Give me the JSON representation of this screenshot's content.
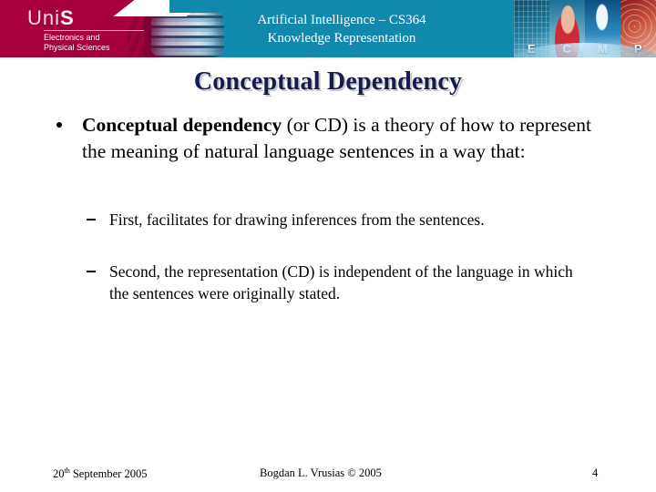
{
  "header": {
    "logo": {
      "brand_prefix": "Uni",
      "brand_suffix": "S",
      "faculty_line1": "Electronics and",
      "faculty_line2": "Physical Sciences"
    },
    "course_title": "Artificial Intelligence – CS364",
    "course_subtitle": "Knowledge Representation",
    "montage_letters": [
      "E",
      "C",
      "M",
      "P"
    ],
    "colors": {
      "maroon": "#a5003c",
      "teal": "#1089ac",
      "white": "#ffffff"
    }
  },
  "slide": {
    "title": "Conceptual Dependency",
    "title_color": "#151c4d",
    "title_shadow_color": "#c8c8c8",
    "bullets": [
      {
        "level": 1,
        "marker": "bullet-dot",
        "bold_lead": "Conceptual dependency",
        "rest": " (or CD) is a theory of how to represent the meaning of natural language sentences in a way that:"
      },
      {
        "level": 2,
        "marker": "en-dash",
        "text": "First, facilitates  for drawing inferences from the sentences."
      },
      {
        "level": 2,
        "marker": "en-dash",
        "text": "Second, the representation (CD) is independent of the language in which the sentences were originally stated."
      }
    ]
  },
  "footer": {
    "date_number": "20",
    "date_ordinal": "th",
    "date_rest": " September 2005",
    "author": "Bogdan L. Vrusias © 2005",
    "page_number": "4"
  }
}
